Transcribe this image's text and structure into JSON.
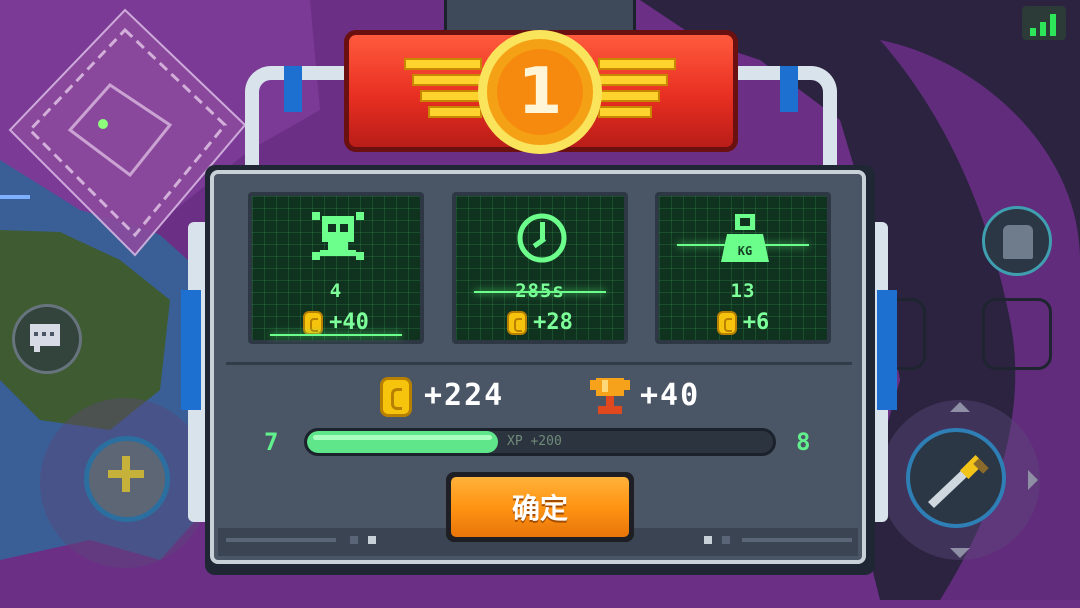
{
  "results": {
    "rank": "1",
    "stats": [
      {
        "icon": "skull-crossbones-icon",
        "value": "4",
        "reward": "+40"
      },
      {
        "icon": "clock-icon",
        "value": "285s",
        "reward": "+28"
      },
      {
        "icon": "weight-kg-icon",
        "icon_text": "KG",
        "value": "13",
        "reward": "+6"
      }
    ],
    "total_coins": "+224",
    "trophies": "+40",
    "xp": {
      "current_level": "7",
      "next_level": "8",
      "gain_text": "XP +200",
      "progress": 0.41
    },
    "confirm_label": "确定"
  },
  "colors": {
    "accent_green": "#7dff9a",
    "button_orange": "#ff9413",
    "banner_red": "#e82f22"
  }
}
